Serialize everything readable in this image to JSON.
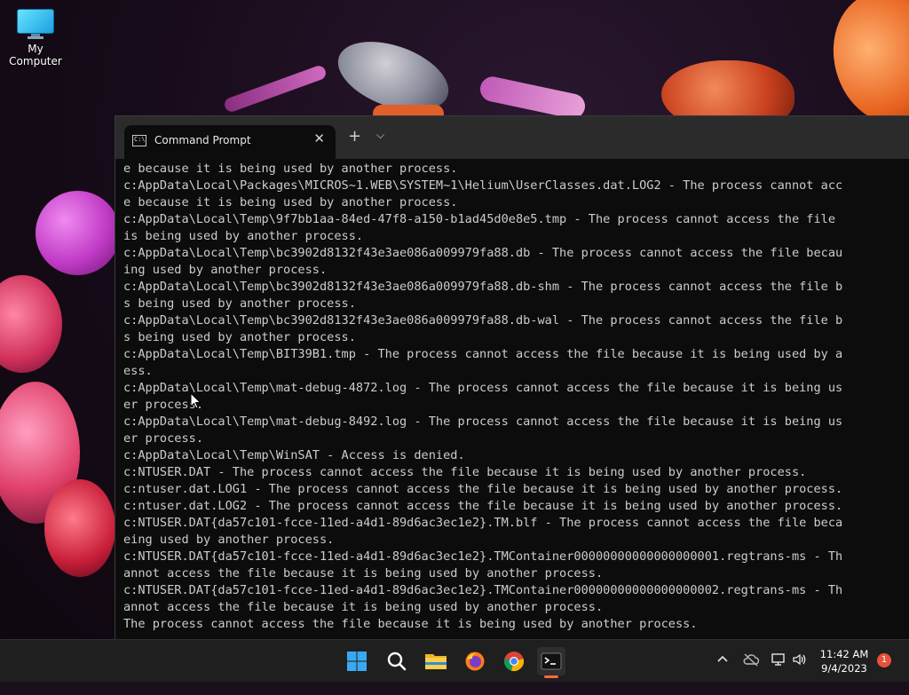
{
  "desktop": {
    "icons": [
      {
        "label": "My Computer",
        "icon": "monitor-icon"
      }
    ]
  },
  "window": {
    "tab_title": "Command Prompt",
    "tab_icon": "command-prompt-icon",
    "tab_icon_glyph": "C:\\",
    "close_glyph": "✕",
    "new_tab_glyph": "+",
    "dropdown_glyph": "⌵"
  },
  "console": {
    "lines": [
      "e because it is being used by another process.",
      "c:AppData\\Local\\Packages\\MICROS~1.WEB\\SYSTEM~1\\Helium\\UserClasses.dat.LOG2 - The process cannot acc",
      "e because it is being used by another process.",
      "c:AppData\\Local\\Temp\\9f7bb1aa-84ed-47f8-a150-b1ad45d0e8e5.tmp - The process cannot access the file",
      "is being used by another process.",
      "c:AppData\\Local\\Temp\\bc3902d8132f43e3ae086a009979fa88.db - The process cannot access the file becau",
      "ing used by another process.",
      "c:AppData\\Local\\Temp\\bc3902d8132f43e3ae086a009979fa88.db-shm - The process cannot access the file b",
      "s being used by another process.",
      "c:AppData\\Local\\Temp\\bc3902d8132f43e3ae086a009979fa88.db-wal - The process cannot access the file b",
      "s being used by another process.",
      "c:AppData\\Local\\Temp\\BIT39B1.tmp - The process cannot access the file because it is being used by a",
      "ess.",
      "c:AppData\\Local\\Temp\\mat-debug-4872.log - The process cannot access the file because it is being us",
      "er process.",
      "c:AppData\\Local\\Temp\\mat-debug-8492.log - The process cannot access the file because it is being us",
      "er process.",
      "c:AppData\\Local\\Temp\\WinSAT - Access is denied.",
      "c:NTUSER.DAT - The process cannot access the file because it is being used by another process.",
      "c:ntuser.dat.LOG1 - The process cannot access the file because it is being used by another process.",
      "c:ntuser.dat.LOG2 - The process cannot access the file because it is being used by another process.",
      "c:NTUSER.DAT{da57c101-fcce-11ed-a4d1-89d6ac3ec1e2}.TM.blf - The process cannot access the file beca",
      "eing used by another process.",
      "c:NTUSER.DAT{da57c101-fcce-11ed-a4d1-89d6ac3ec1e2}.TMContainer00000000000000000001.regtrans-ms - Th",
      "annot access the file because it is being used by another process.",
      "c:NTUSER.DAT{da57c101-fcce-11ed-a4d1-89d6ac3ec1e2}.TMContainer00000000000000000002.regtrans-ms - Th",
      "annot access the file because it is being used by another process.",
      "The process cannot access the file because it is being used by another process."
    ]
  },
  "taskbar": {
    "apps": [
      {
        "name": "start-button",
        "icon": "windows-logo-icon"
      },
      {
        "name": "search-button",
        "icon": "search-icon"
      },
      {
        "name": "file-explorer-button",
        "icon": "folder-icon"
      },
      {
        "name": "firefox-button",
        "icon": "firefox-icon"
      },
      {
        "name": "chrome-button",
        "icon": "chrome-icon"
      },
      {
        "name": "terminal-button",
        "icon": "terminal-icon",
        "active": true
      }
    ],
    "tray": {
      "chevron_glyph": "^",
      "time": "11:42 AM",
      "date": "9/4/2023",
      "notification_count": "1"
    },
    "accent_color": "#ff6a3d"
  }
}
